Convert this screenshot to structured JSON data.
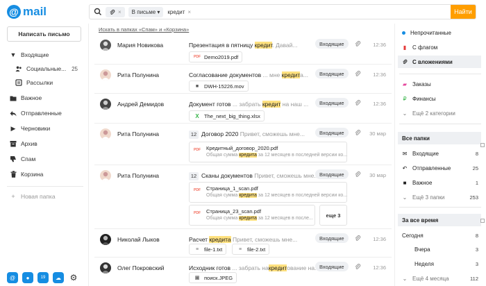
{
  "logo": {
    "symbol": "@",
    "text": "mail"
  },
  "search": {
    "chip_attach_x": "×",
    "chip_scope": "В письме ▾",
    "query": "кредит",
    "query_x": "×",
    "submit": "Найти"
  },
  "compose": "Написать письмо",
  "folders": [
    {
      "label": "Входящие",
      "icon": "caret-down-icon"
    },
    {
      "label": "Социальные...",
      "count": "25",
      "icon": "people-icon"
    },
    {
      "label": "Рассылки",
      "icon": "newsletter-icon"
    },
    {
      "label": "Важное",
      "icon": "folder-icon"
    },
    {
      "label": "Отправленные",
      "icon": "reply-icon"
    },
    {
      "label": "Черновики",
      "icon": "caret-right-icon"
    },
    {
      "label": "Архив",
      "icon": "archive-icon"
    },
    {
      "label": "Спам",
      "icon": "thumb-down-icon"
    },
    {
      "label": "Корзина",
      "icon": "trash-icon"
    }
  ],
  "new_folder": "Новая папка",
  "main": {
    "search_in_spam": "Искать в папках «Спам» и «Корзина»",
    "rows": [
      {
        "sender": "Мария Новикова",
        "subject": "Презентация в пятницу",
        "pre": " ",
        "hl": "кредит",
        "post": ". Давай...",
        "badge": "Входящие",
        "time": "12:36",
        "att": [
          "Demo2019.pdf"
        ]
      },
      {
        "sender": "Рита Полунина",
        "subject": "Согласование документов",
        "pre": " ... мне ",
        "hl": "кредит",
        "post": "а...",
        "badge": "Входящие",
        "time": "12:36",
        "att": [
          "DWH-15226.mov"
        ]
      },
      {
        "sender": "Андрей Демидов",
        "subject": "Документ готов",
        "pre": " ... забрать ",
        "hl": "кредит",
        "post": " на наш ...",
        "badge": "Входящие",
        "time": "12:36",
        "att": [
          "The_next_big_thing.xlsx"
        ]
      },
      {
        "sender": "Рита Полунина",
        "num": "12",
        "subject": "Договор 2020",
        "pre": " Привет, сможешь мне...",
        "hl": "",
        "post": "",
        "badge": "Входящие",
        "time": "30 мар",
        "big": [
          {
            "t": "Кредитный_договор_2020.pdf",
            "d1": "Общая сумма ",
            "dh": "кредита",
            "d2": " за 12 месяцев в последней версии ко..."
          }
        ]
      },
      {
        "sender": "Рита Полунина",
        "num": "12",
        "subject": "Сканы документов",
        "pre": " Привет, сможешь мне...",
        "hl": "",
        "post": "",
        "badge": "Входящие",
        "time": "30 мар",
        "big": [
          {
            "t": "Страница_1_scan.pdf",
            "d1": "Общая сумма ",
            "dh": "кредита",
            "d2": " за 12 месяцев в последней версии ко..."
          },
          {
            "t": "Страница_23_scan.pdf",
            "d1": "Общая сумма ",
            "dh": "кредита",
            "d2": " за 12 месяцев в после..."
          }
        ],
        "more": "еще 3"
      },
      {
        "sender": "Николай Лыков",
        "subject": "Расчет ",
        "subject_hl": "кредита",
        "pre": " Привет, сможешь мне...",
        "hl": "",
        "post": "",
        "badge": "Входящие",
        "time": "12:36",
        "att": [
          "file-1.txt",
          "file-2.txt"
        ]
      },
      {
        "sender": "Олег Покровский",
        "subject": "Исходник готов",
        "pre": " ... забрать на",
        "hl": "кредит",
        "post": "ование на...",
        "badge": "Входящие",
        "time": "12:36",
        "att": [
          "поиск.JPEG"
        ]
      }
    ]
  },
  "filters": [
    {
      "label": "Непрочитанные",
      "color": "#168de2"
    },
    {
      "label": "С флагом",
      "color": "#e43a3a"
    },
    {
      "label": "С вложениями"
    }
  ],
  "categories": [
    {
      "label": "Заказы",
      "icon": "cart-icon",
      "color": "#e5489e"
    },
    {
      "label": "Финансы",
      "icon": "ruble-icon",
      "color": "#39b54a"
    },
    {
      "label": "Ещё 2 категории"
    }
  ],
  "all_folders": {
    "title": "Все папки",
    "items": [
      {
        "label": "Входящие",
        "count": "8"
      },
      {
        "label": "Отправленные",
        "count": "25"
      },
      {
        "label": "Важное",
        "count": "1"
      },
      {
        "label": "Ещё 3 папки",
        "count": "253"
      }
    ]
  },
  "period": {
    "title": "За все время",
    "items": [
      {
        "label": "Сегодня",
        "count": "8"
      },
      {
        "label": "Вчера",
        "count": "3"
      },
      {
        "label": "Неделя",
        "count": "3"
      },
      {
        "label": "Ещё 4 месяца",
        "count": "112"
      }
    ]
  }
}
